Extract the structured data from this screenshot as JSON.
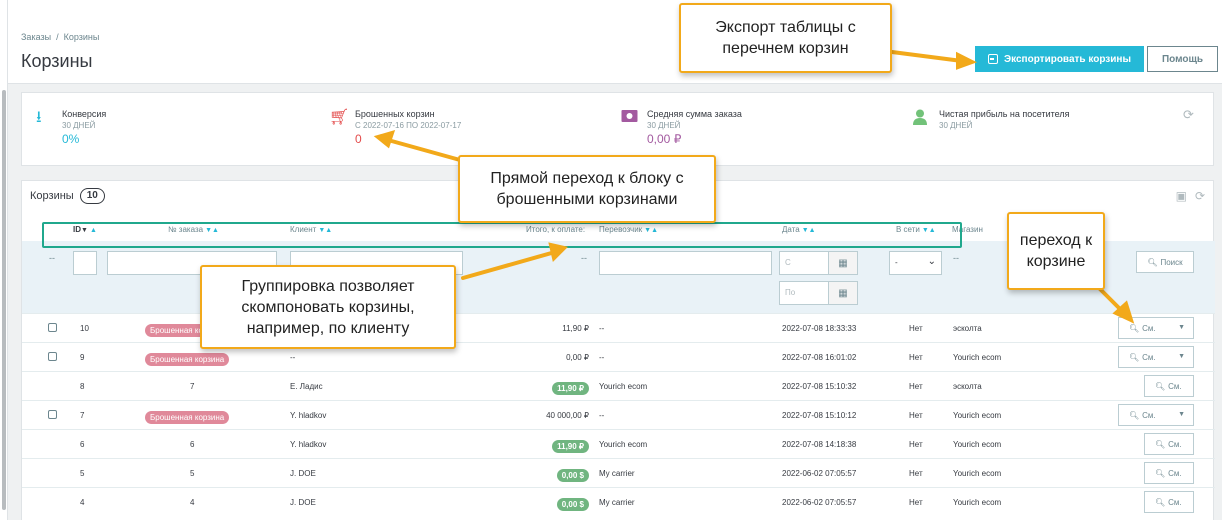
{
  "breadcrumb": {
    "items": [
      "Заказы",
      "Корзины"
    ],
    "sep": "/"
  },
  "page_title": "Корзины",
  "header_buttons": {
    "export": "Экспортировать корзины",
    "help": "Помощь"
  },
  "kpis": [
    {
      "title": "Конверсия",
      "sub": "30 ДНЕЙ",
      "value": "0%",
      "icon": "funnel-sort-icon",
      "color": "#25b9d7"
    },
    {
      "title": "Брошенных корзин",
      "sub": "С 2022-07-16 ПО 2022-07-17",
      "value": "0",
      "icon": "cart-icon",
      "color": "#e34b4b"
    },
    {
      "title": "Средняя сумма заказа",
      "sub": "30 ДНЕЙ",
      "value": "0,00 ₽",
      "icon": "money-icon",
      "color": "#a35aa0"
    },
    {
      "title": "Чистая прибыль на посетителя",
      "sub": "30 ДНЕЙ",
      "value": "",
      "icon": "user-icon",
      "color": "#72c279"
    }
  ],
  "carts": {
    "title": "Корзины",
    "count": "10",
    "columns": {
      "id": "ID",
      "order": "№ заказа",
      "client": "Клиент",
      "total": "Итого, к оплате:",
      "carrier": "Перевозчик",
      "date": "Дата",
      "online": "В сети",
      "shop": "Магазин"
    },
    "filters": {
      "dash": "--",
      "date_from_placeholder": "С",
      "date_to_placeholder": "По",
      "online_value": "-",
      "search_button": "Поиск"
    },
    "rows": [
      {
        "id": "10",
        "order": "Брошенная корзина",
        "abandoned": true,
        "client": "--",
        "total": "11,90 ₽",
        "total_badge": false,
        "carrier": "--",
        "date": "2022-07-08 18:33:33",
        "online": "Нет",
        "shop": "эсколта",
        "checkbox": true,
        "see": "См.",
        "dropdown": true
      },
      {
        "id": "9",
        "order": "Брошенная корзина",
        "abandoned": true,
        "client": "--",
        "total": "0,00 ₽",
        "total_badge": false,
        "carrier": "--",
        "date": "2022-07-08 16:01:02",
        "online": "Нет",
        "shop": "Yourich ecom",
        "checkbox": true,
        "see": "См.",
        "dropdown": true
      },
      {
        "id": "8",
        "order": "7",
        "abandoned": false,
        "client": "Е. Ладис",
        "total": "11,90 ₽",
        "total_badge": true,
        "carrier": "Yourich ecom",
        "date": "2022-07-08 15:10:32",
        "online": "Нет",
        "shop": "эсколта",
        "checkbox": false,
        "see": "См.",
        "dropdown": false
      },
      {
        "id": "7",
        "order": "Брошенная корзина",
        "abandoned": true,
        "client": "Y. hladkov",
        "total": "40 000,00 ₽",
        "total_badge": false,
        "carrier": "--",
        "date": "2022-07-08 15:10:12",
        "online": "Нет",
        "shop": "Yourich ecom",
        "checkbox": true,
        "see": "См.",
        "dropdown": true
      },
      {
        "id": "6",
        "order": "6",
        "abandoned": false,
        "client": "Y. hladkov",
        "total": "11,90 ₽",
        "total_badge": true,
        "carrier": "Yourich ecom",
        "date": "2022-07-08 14:18:38",
        "online": "Нет",
        "shop": "Yourich ecom",
        "checkbox": false,
        "see": "См.",
        "dropdown": false
      },
      {
        "id": "5",
        "order": "5",
        "abandoned": false,
        "client": "J. DOE",
        "total": "0,00 $",
        "total_badge": true,
        "carrier": "My carrier",
        "date": "2022-06-02 07:05:57",
        "online": "Нет",
        "shop": "Yourich ecom",
        "checkbox": false,
        "see": "См.",
        "dropdown": false
      },
      {
        "id": "4",
        "order": "4",
        "abandoned": false,
        "client": "J. DOE",
        "total": "0,00 $",
        "total_badge": true,
        "carrier": "My carrier",
        "date": "2022-06-02 07:05:57",
        "online": "Нет",
        "shop": "Yourich ecom",
        "checkbox": false,
        "see": "См.",
        "dropdown": false
      }
    ]
  },
  "annotations": {
    "export": "Экспорт таблицы с перечнем корзин",
    "abandoned": "Прямой переход к блоку с брошенными корзинами",
    "grouping": "Группировка позволяет скомпоновать корзины, например, по клиенту",
    "goto_cart": "переход к корзине"
  },
  "colors": {
    "accent": "#25b9d7",
    "callout_border": "#f2a91a",
    "frame": "#20a88d",
    "abandoned_badge": "#e0899a",
    "paid_badge": "#70b580"
  }
}
